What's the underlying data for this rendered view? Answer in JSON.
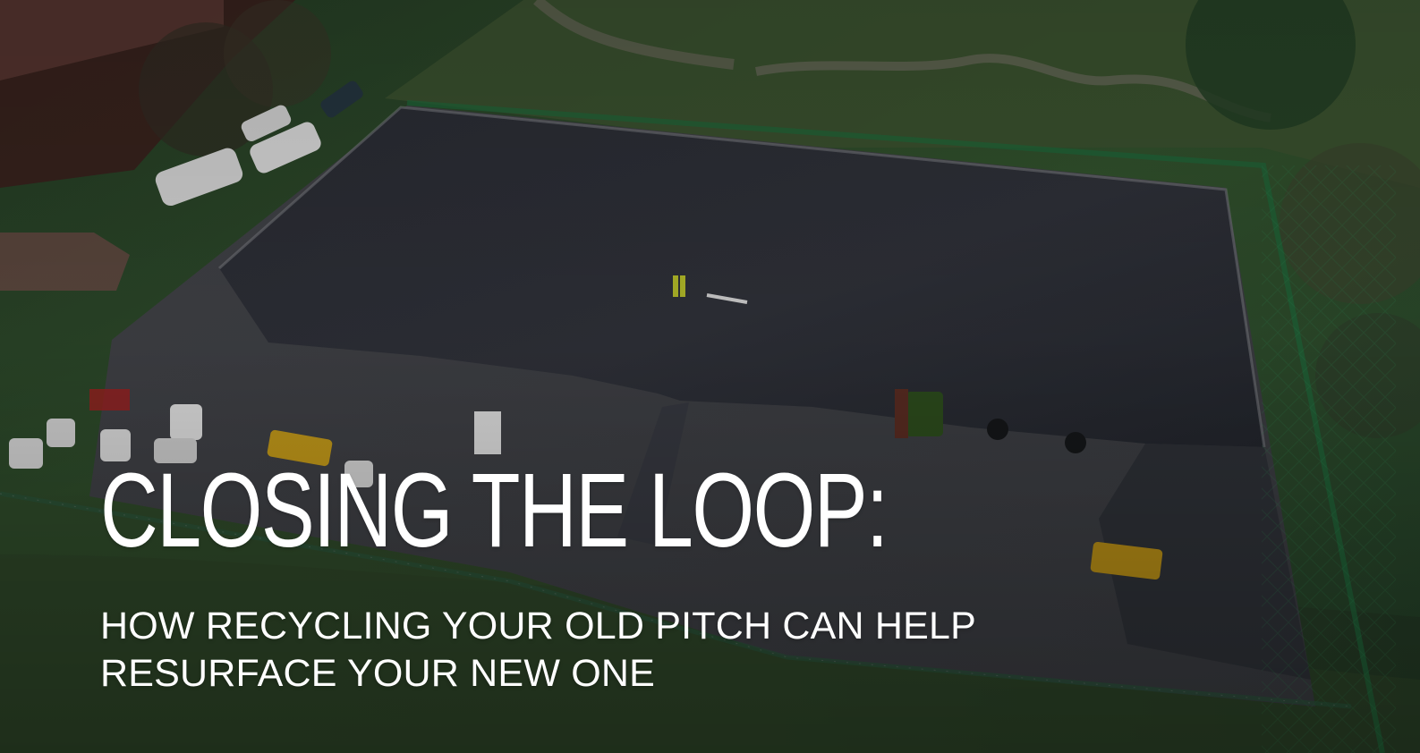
{
  "hero": {
    "title": "CLOSING THE LOOP:",
    "subtitle_line_1": "HOW RECYCLING YOUR OLD PITCH CAN HELP",
    "subtitle_line_2": "RESURFACE YOUR NEW ONE"
  },
  "colors": {
    "text": "#ffffff",
    "pitch": "#2d3038",
    "grass": "#2c4a2b",
    "fence": "#1f6b40"
  },
  "image": {
    "subject": "aerial-view-sports-pitch-resurfacing"
  }
}
